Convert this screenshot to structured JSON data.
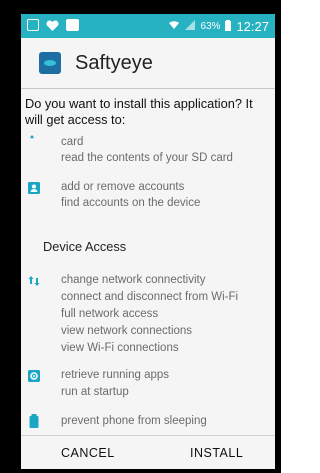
{
  "status_bar": {
    "battery_text": "63%",
    "time": "12:27"
  },
  "app": {
    "name": "Saftyeye"
  },
  "prompt": {
    "question": "Do you want to install this application? It will get access to:"
  },
  "permissions": {
    "storage": [
      "card",
      "read the contents of your SD card"
    ],
    "accounts": [
      "add or remove accounts",
      "find accounts on the device"
    ],
    "section_title": "Device Access",
    "network": [
      "change network connectivity",
      "connect and disconnect from Wi-Fi",
      "full network access",
      "view network connections",
      "view Wi-Fi connections"
    ],
    "apps": [
      "retrieve running apps",
      "run at startup"
    ],
    "power": [
      "prevent phone from sleeping"
    ]
  },
  "actions": {
    "cancel": "CANCEL",
    "install": "INSTALL"
  },
  "colors": {
    "status_bar": "#27b2c2",
    "icon_accent": "#1aa7c6"
  },
  "icons": {
    "storage": "dot-icon",
    "accounts": "account-box-icon",
    "network": "network-arrows-icon",
    "apps": "gear-icon",
    "power": "battery-icon"
  }
}
